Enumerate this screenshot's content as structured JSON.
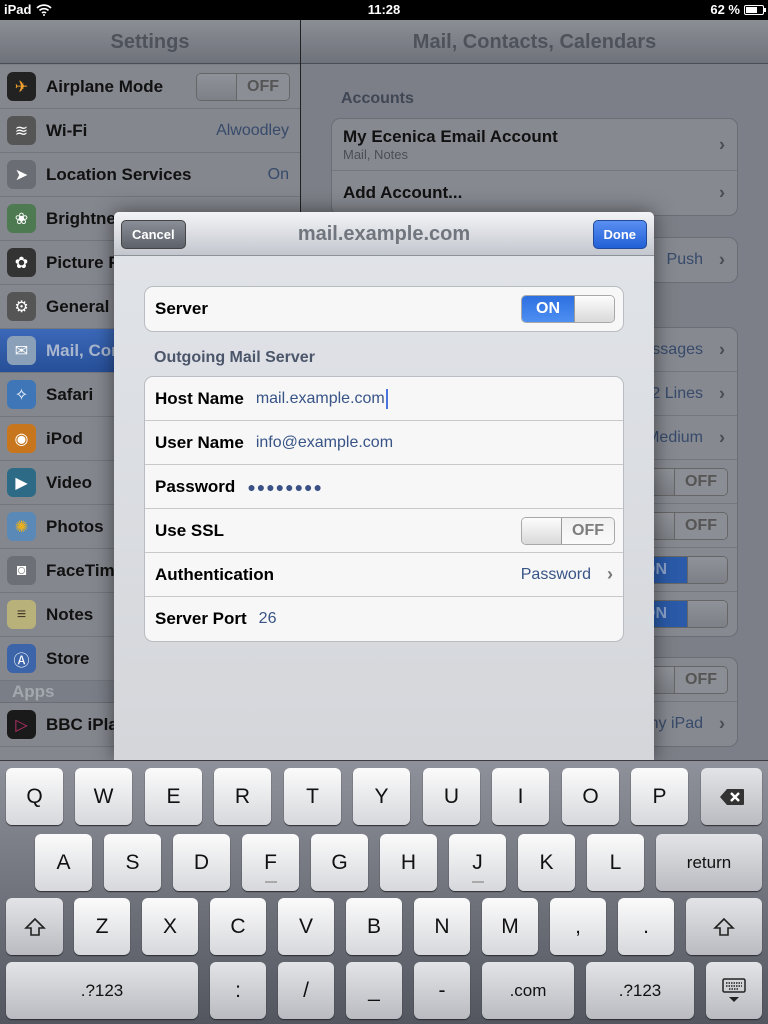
{
  "status_bar": {
    "device": "iPad",
    "time": "11:28",
    "battery": "62 %"
  },
  "settings_nav_title": "Settings",
  "detail_nav_title": "Mail, Contacts, Calendars",
  "sidebar": {
    "items": [
      {
        "label": "Airplane Mode",
        "icon": "airplane-icon",
        "toggle": "OFF"
      },
      {
        "label": "Wi-Fi",
        "icon": "wifi-icon",
        "value": "Alwoodley"
      },
      {
        "label": "Location Services",
        "icon": "location-icon",
        "value": "On"
      },
      {
        "label": "Brightness & Wallpaper",
        "icon": "brightness-icon"
      },
      {
        "label": "Picture Frame",
        "icon": "picture-frame-icon"
      },
      {
        "label": "General",
        "icon": "gear-icon"
      },
      {
        "label": "Mail, Contacts, Calendars",
        "icon": "mail-icon",
        "selected": true
      },
      {
        "label": "Safari",
        "icon": "safari-icon"
      },
      {
        "label": "iPod",
        "icon": "ipod-icon"
      },
      {
        "label": "Video",
        "icon": "video-icon"
      },
      {
        "label": "Photos",
        "icon": "photos-icon"
      },
      {
        "label": "FaceTime",
        "icon": "facetime-icon"
      },
      {
        "label": "Notes",
        "icon": "notes-icon"
      },
      {
        "label": "Store",
        "icon": "store-icon"
      }
    ],
    "apps_header": "Apps",
    "apps": [
      {
        "label": "BBC iPlayer",
        "icon": "bbc-iplayer-icon"
      }
    ]
  },
  "detail": {
    "accounts_header": "Accounts",
    "accounts": [
      {
        "title": "My Ecenica Email Account",
        "subtitle": "Mail, Notes"
      },
      {
        "title": "Add Account..."
      }
    ],
    "fetch_value": "Push",
    "mail_values": [
      "ssages",
      "2 Lines",
      "Medium"
    ],
    "toggles": [
      "OFF",
      "OFF",
      "ON",
      "ON"
    ],
    "toggle_lower": "OFF",
    "signature_value": "ny iPad"
  },
  "modal": {
    "title": "mail.example.com",
    "cancel_label": "Cancel",
    "done_label": "Done",
    "server_label": "Server",
    "server_toggle": "ON",
    "section_header": "Outgoing Mail Server",
    "fields": {
      "host_label": "Host Name",
      "host_value": "mail.example.com",
      "user_label": "User Name",
      "user_value": "info@example.com",
      "password_label": "Password",
      "password_value": "●●●●●●●●",
      "ssl_label": "Use SSL",
      "ssl_toggle": "OFF",
      "auth_label": "Authentication",
      "auth_value": "Password",
      "port_label": "Server Port",
      "port_value": "26"
    }
  },
  "keyboard": {
    "row1": [
      "Q",
      "W",
      "E",
      "R",
      "T",
      "Y",
      "U",
      "I",
      "O",
      "P"
    ],
    "row2": [
      "A",
      "S",
      "D",
      "F",
      "G",
      "H",
      "J",
      "K",
      "L"
    ],
    "row3": [
      "Z",
      "X",
      "C",
      "V",
      "B",
      "N",
      "M",
      ",",
      "."
    ],
    "return_label": "return",
    "num_label": ".?123",
    "row4": [
      ":",
      "/",
      "_",
      "-"
    ],
    "dotcom_label": ".com"
  }
}
